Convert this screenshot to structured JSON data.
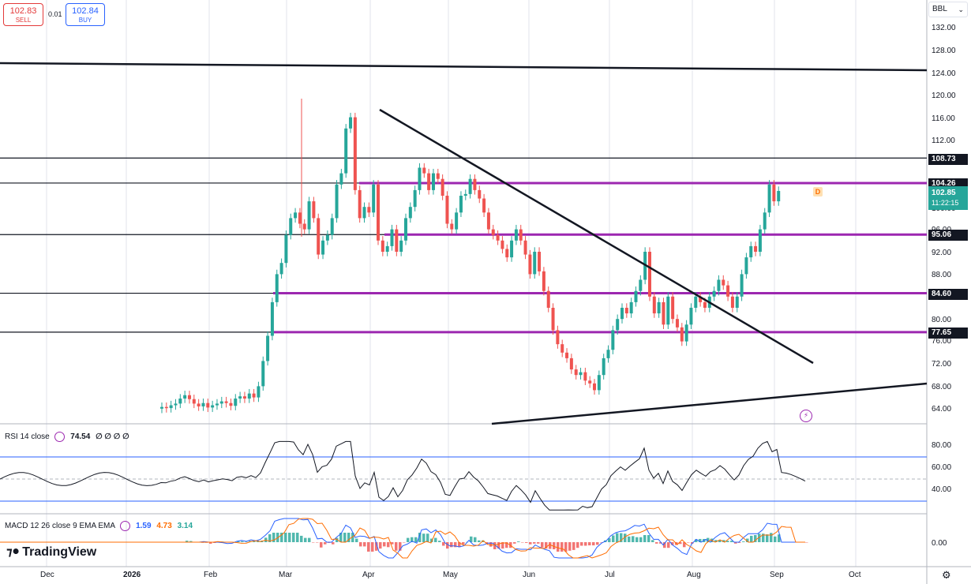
{
  "trade": {
    "sell_price": "102.83",
    "sell_label": "SELL",
    "buy_price": "102.84",
    "buy_label": "BUY",
    "spread": "0.01"
  },
  "symbol": {
    "currency": "BBL"
  },
  "price_axis": {
    "labels": [
      "132.00",
      "128.00",
      "124.00",
      "120.00",
      "116.00",
      "112.00",
      "100.00",
      "96.00",
      "92.00",
      "88.00",
      "80.00",
      "76.00",
      "72.00",
      "68.00",
      "64.00"
    ],
    "tags": {
      "t1": "108.73",
      "t2": "104.26",
      "t3": "95.06",
      "t4": "84.60",
      "t5": "77.65"
    },
    "current_price": "102.85",
    "countdown": "11:22:15"
  },
  "time_axis": {
    "labels": [
      "Dec",
      "2026",
      "Feb",
      "Mar",
      "Apr",
      "May",
      "Jun",
      "Jul",
      "Aug",
      "Sep",
      "Oct"
    ]
  },
  "rsi": {
    "title": "RSI 14 close",
    "value": "74.54",
    "extras": "∅ ∅ ∅ ∅",
    "axis": [
      "80.00",
      "60.00",
      "40.00"
    ]
  },
  "macd": {
    "title": "MACD 12 26 close 9 EMA EMA",
    "macd": "1.59",
    "signal": "4.73",
    "hist": "3.14",
    "axis": "0.00"
  },
  "badges": {
    "session": "D"
  },
  "logo": {
    "text": "TradingView"
  },
  "colors": {
    "up": "#26a69a",
    "down": "#ef5350",
    "level": "#9c27b0",
    "rsi": "#131722",
    "macd": "#2962ff",
    "signal": "#ff6d00"
  },
  "chart_data": {
    "type": "candlestick",
    "price_range": [
      62,
      134
    ],
    "horizontal_levels": [
      108.73,
      104.26,
      95.06,
      84.6,
      77.65
    ],
    "closes": [
      64.3,
      64.1,
      64.6,
      64.9,
      65.8,
      66.4,
      65.7,
      64.9,
      64.4,
      65.0,
      64.2,
      64.6,
      64.9,
      65.3,
      65.0,
      64.5,
      65.8,
      66.2,
      65.8,
      66.7,
      66.0,
      68.0,
      72.5,
      77.0,
      83.0,
      88.0,
      90.0,
      95.0,
      98.0,
      99.0,
      97.0,
      96.0,
      101.0,
      98.0,
      91.5,
      94.0,
      95.0,
      98.0,
      104.0,
      106.0,
      114.0,
      116.0,
      103.0,
      98.0,
      100.0,
      99.0,
      104.0,
      94.0,
      92.0,
      93.0,
      96.0,
      92.0,
      94.0,
      98.0,
      100.0,
      103.0,
      107.0,
      106.0,
      103.0,
      106.0,
      105.0,
      102.0,
      97.0,
      96.0,
      99.0,
      102.0,
      102.3,
      105.0,
      103.0,
      101.5,
      99.0,
      96.0,
      95.0,
      94.0,
      92.5,
      91.0,
      94.0,
      96.0,
      94.0,
      91.5,
      88.0,
      92.0,
      88.5,
      85.0,
      82.0,
      78.0,
      75.5,
      74.0,
      73.0,
      71.0,
      70.0,
      70.5,
      69.0,
      68.5,
      67.3,
      70.0,
      73.0,
      74.5,
      78.0,
      80.0,
      82.0,
      81.0,
      83.0,
      85.0,
      87.0,
      92.0,
      84.0,
      81.0,
      83.0,
      79.0,
      84.0,
      80.0,
      78.5,
      76.0,
      79.0,
      82.0,
      84.0,
      83.0,
      82.0,
      84.0,
      85.0,
      87.0,
      86.0,
      84.0,
      82.0,
      84.0,
      88.0,
      91.0,
      93.0,
      92.0,
      96.0,
      99.0,
      104.0,
      101.0,
      102.85
    ]
  }
}
